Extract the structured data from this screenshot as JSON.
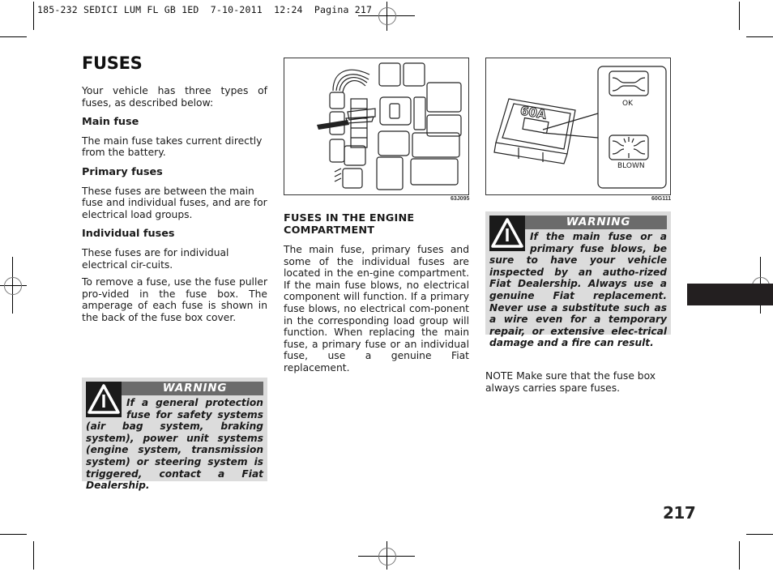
{
  "slug": {
    "text": "185-232 SEDICI LUM FL GB 1ED  7-10-2011  12:24  Pagina 217"
  },
  "page": {
    "title": "FUSES",
    "number": "217"
  },
  "left_column": {
    "intro": "Your vehicle has three types of fuses, as described below:",
    "sections": [
      {
        "heading": "Main fuse",
        "text": "The main fuse takes current directly from the battery."
      },
      {
        "heading": "Primary fuses",
        "text": "These fuses are between the main fuse and individual fuses, and are for electrical load groups."
      },
      {
        "heading": "Individual fuses",
        "text": "These fuses are for individual electrical cir-cuits."
      }
    ],
    "removal_text": "To remove a fuse, use the fuse puller pro-vided in the fuse box. The amperage of each fuse is shown in the back of the fuse box cover.",
    "warning": {
      "label": "WARNING",
      "icon": "warning-triangle-icon",
      "text": "If a general protection fuse for safety systems (air bag system, braking system), power unit systems (engine system, transmission system) or steering system is triggered, contact a Fiat Dealership."
    }
  },
  "middle_column": {
    "figure": {
      "code": "63J095",
      "description": "fuse puller removing fuse from engine compartment fuse box"
    },
    "heading": "FUSES IN THE ENGINE COMPARTMENT",
    "text": "The main fuse, primary fuses and some of the individual fuses are located in the en-gine compartment. If the main fuse blows, no electrical component will function. If a primary fuse blows, no electrical com-ponent in the corresponding load group will function. When replacing the main fuse, a primary fuse or an individual fuse, use a genuine Fiat replacement."
  },
  "right_column": {
    "figure": {
      "code": "60G111",
      "fuse_rating": "60A",
      "label_ok": "OK",
      "label_blown": "BLOWN"
    },
    "warning": {
      "label": "WARNING",
      "icon": "warning-triangle-icon",
      "text": "If the main fuse or a primary fuse blows, be sure to have your vehicle inspected by an autho-rized Fiat Dealership. Always use a genuine Fiat replacement. Never use a substitute such as a wire even for a temporary repair, or extensive elec-trical damage and a fire can result."
    },
    "note": "NOTE Make sure that the fuse box always carries spare fuses."
  },
  "colors": {
    "warning_box_bg": "#dcdcdc",
    "warning_header_bg": "#6b6b6b",
    "section_tab": "#231f20"
  }
}
